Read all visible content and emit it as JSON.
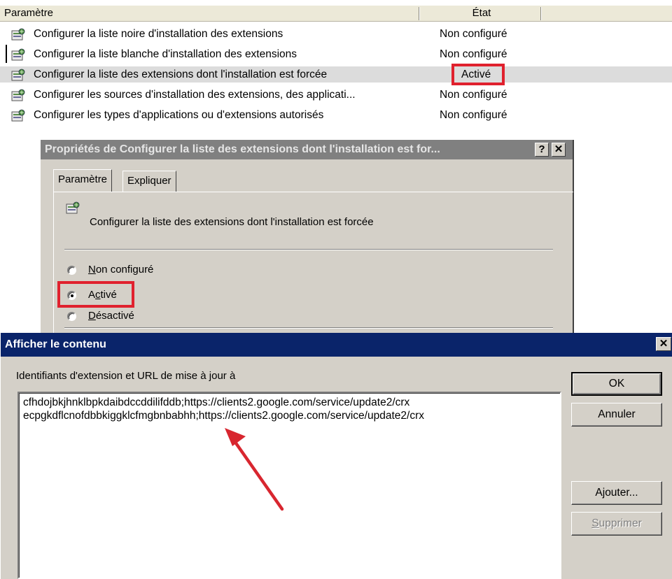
{
  "policy_list": {
    "header": {
      "param": "Paramètre",
      "state": "État"
    },
    "rows": [
      {
        "label": "Configurer la liste noire d'installation des extensions",
        "state": "Non configuré"
      },
      {
        "label": "Configurer la liste blanche d'installation des extensions",
        "state": "Non configuré"
      },
      {
        "label": "Configurer la liste des extensions dont l'installation est forcée",
        "state": "Activé"
      },
      {
        "label": "Configurer les sources d'installation des extensions, des applicati...",
        "state": "Non configuré"
      },
      {
        "label": "Configurer les types d'applications ou d'extensions autorisés",
        "state": "Non configuré"
      }
    ]
  },
  "properties_dialog": {
    "title": "Propriétés de Configurer la liste des extensions dont l'installation est for...",
    "help_glyph": "?",
    "close_glyph": "✕",
    "tabs": [
      "Paramètre",
      "Expliquer"
    ],
    "setting_name": "Configurer la liste des extensions dont l'installation est forcée",
    "options": [
      {
        "key": "N",
        "rest": "on configuré",
        "selected": false
      },
      {
        "pre": "A",
        "key": "c",
        "rest": "tivé",
        "selected": true
      },
      {
        "key": "D",
        "rest": "ésactivé",
        "selected": false
      }
    ]
  },
  "show_contents_dialog": {
    "title": "Afficher le contenu",
    "close_glyph": "✕",
    "label": "Identifiants d'extension et URL de mise à jour à",
    "entries": [
      "cfhdojbkjhnklbpkdaibdccddilifddb;https://clients2.google.com/service/update2/crx",
      "ecpgkdflcnofdbbkiggklcfmgbnbabhh;https://clients2.google.com/service/update2/crx"
    ],
    "buttons": {
      "ok": "OK",
      "cancel": "Annuler",
      "add": "Ajouter...",
      "remove_key": "S",
      "remove_rest": "upprimer"
    }
  },
  "colors": {
    "highlight": "#e0212e",
    "arrow": "#d8262f",
    "title_active": "#0a246a",
    "title_inactive": "#808080"
  },
  "icons": [
    "policy-setting-icon",
    "radio-button-icon",
    "red-arrow-annotation"
  ]
}
